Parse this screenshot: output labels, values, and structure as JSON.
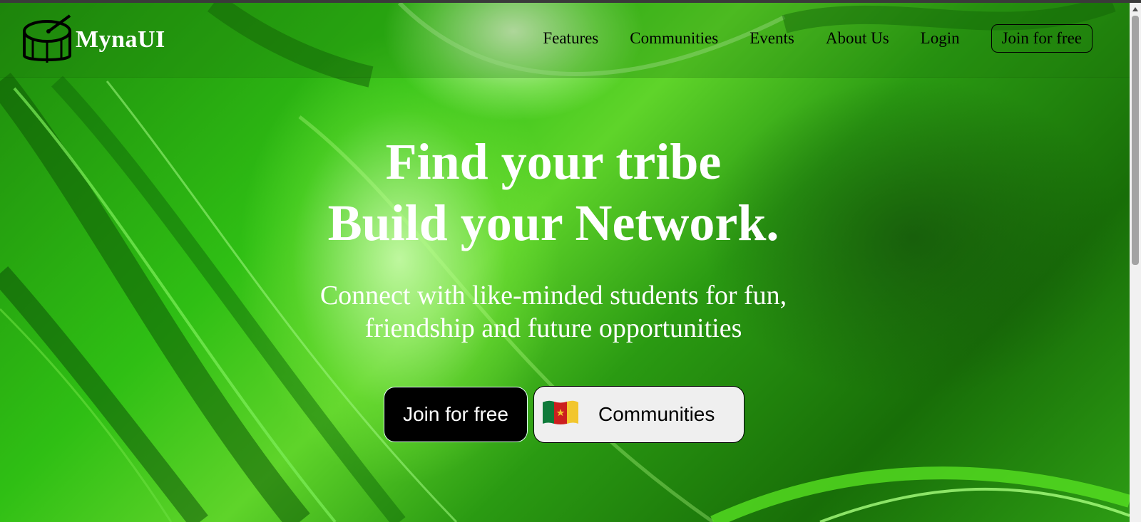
{
  "brand": {
    "name": "MynaUI",
    "logo_icon": "drum-icon"
  },
  "nav": {
    "links": [
      "Features",
      "Communities",
      "Events",
      "About Us",
      "Login"
    ],
    "join_label": "Join for free"
  },
  "hero": {
    "title_line1": "Find your tribe",
    "title_line2": "Build your Network.",
    "subtitle": "Connect with like-minded students for fun, friendship and future opportunities"
  },
  "cta": {
    "join_label": "Join for free",
    "communities_label": "Communities",
    "communities_icon": "cameroon-flag-icon"
  },
  "colors": {
    "background_green": "#2fbf14",
    "text_white": "#ffffff",
    "button_black": "#000000"
  }
}
